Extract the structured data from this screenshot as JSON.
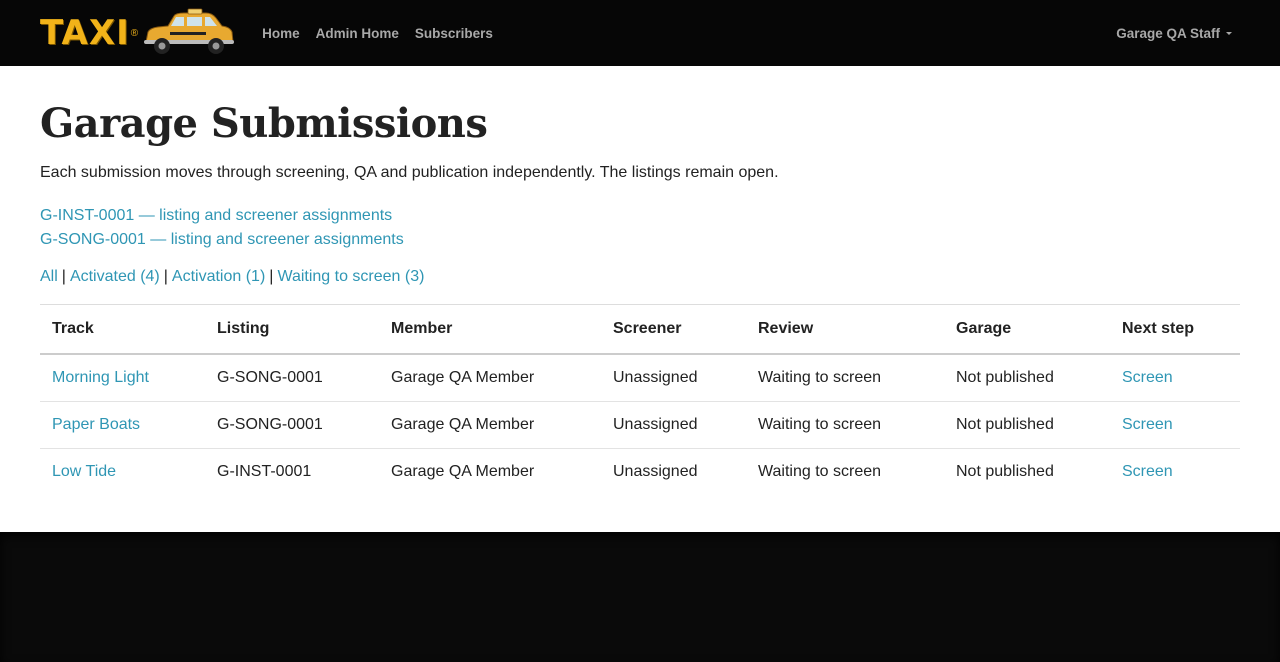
{
  "brand": {
    "name": "TAXI",
    "reg": "®"
  },
  "nav": {
    "links": [
      "Home",
      "Admin Home",
      "Subscribers"
    ],
    "user_menu": "Garage QA Staff"
  },
  "page": {
    "title": "Garage Submissions",
    "intro": "Each submission moves through screening, QA and publication independently. The listings remain open.",
    "listing_links": [
      "G-INST-0001 — listing and screener assignments",
      "G-SONG-0001 — listing and screener assignments"
    ],
    "filters": [
      "All",
      "Activated (4)",
      "Activation (1)",
      "Waiting to screen (3)"
    ]
  },
  "table": {
    "headers": [
      "Track",
      "Listing",
      "Member",
      "Screener",
      "Review",
      "Garage",
      "Next step"
    ],
    "rows": [
      {
        "track": "Morning Light",
        "listing": "G-SONG-0001",
        "member": "Garage QA Member",
        "screener": "Unassigned",
        "review": "Waiting to screen",
        "garage": "Not published",
        "next": "Screen"
      },
      {
        "track": "Paper Boats",
        "listing": "G-SONG-0001",
        "member": "Garage QA Member",
        "screener": "Unassigned",
        "review": "Waiting to screen",
        "garage": "Not published",
        "next": "Screen"
      },
      {
        "track": "Low Tide",
        "listing": "G-INST-0001",
        "member": "Garage QA Member",
        "screener": "Unassigned",
        "review": "Waiting to screen",
        "garage": "Not published",
        "next": "Screen"
      }
    ]
  },
  "colors": {
    "link": "#2f96b4",
    "navbar": "#060606",
    "logo": "#f2b319"
  }
}
